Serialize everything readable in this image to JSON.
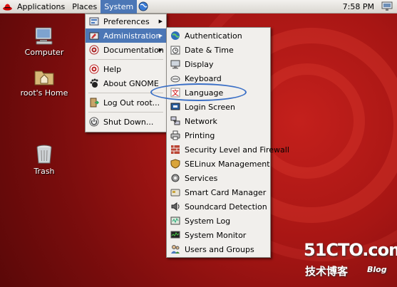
{
  "topbar": {
    "menus": [
      "Applications",
      "Places",
      "System"
    ],
    "active_menu": "System",
    "clock": "7:58 PM"
  },
  "desktop_icons": [
    {
      "label": "Computer",
      "icon": "computer-icon"
    },
    {
      "label": "root's Home",
      "icon": "home-folder-icon"
    },
    {
      "label": "Trash",
      "icon": "trash-icon"
    }
  ],
  "system_menu": {
    "items": [
      {
        "label": "Preferences",
        "icon": "preferences-icon",
        "submenu": true
      },
      {
        "label": "Administration",
        "icon": "administration-icon",
        "submenu": true,
        "selected": true
      },
      {
        "label": "Documentation",
        "icon": "documentation-icon",
        "submenu": true
      },
      {
        "label": "Help",
        "icon": "help-icon"
      },
      {
        "label": "About GNOME",
        "icon": "gnome-foot-icon"
      },
      {
        "label": "Log Out root...",
        "icon": "logout-icon"
      },
      {
        "label": "Shut Down...",
        "icon": "shutdown-icon"
      }
    ]
  },
  "admin_menu": {
    "items": [
      {
        "label": "Authentication",
        "icon": "authentication-icon"
      },
      {
        "label": "Date & Time",
        "icon": "clock-icon"
      },
      {
        "label": "Display",
        "icon": "display-icon"
      },
      {
        "label": "Keyboard",
        "icon": "keyboard-icon"
      },
      {
        "label": "Language",
        "icon": "language-icon",
        "highlighted": true
      },
      {
        "label": "Login Screen",
        "icon": "login-screen-icon"
      },
      {
        "label": "Network",
        "icon": "network-icon"
      },
      {
        "label": "Printing",
        "icon": "printer-icon"
      },
      {
        "label": "Security Level and Firewall",
        "icon": "firewall-icon"
      },
      {
        "label": "SELinux Management",
        "icon": "selinux-icon"
      },
      {
        "label": "Services",
        "icon": "services-icon"
      },
      {
        "label": "Smart Card Manager",
        "icon": "smartcard-icon"
      },
      {
        "label": "Soundcard Detection",
        "icon": "soundcard-icon"
      },
      {
        "label": "System Log",
        "icon": "system-log-icon"
      },
      {
        "label": "System Monitor",
        "icon": "system-monitor-icon"
      },
      {
        "label": "Users and Groups",
        "icon": "users-groups-icon"
      }
    ]
  },
  "watermark": {
    "brand": "51CTO.com",
    "cn": "技术博客",
    "blog": "Blog"
  },
  "colors": {
    "selection": "#4c77b6",
    "annotation": "#3a6fc6",
    "desktop": "#a81614"
  }
}
